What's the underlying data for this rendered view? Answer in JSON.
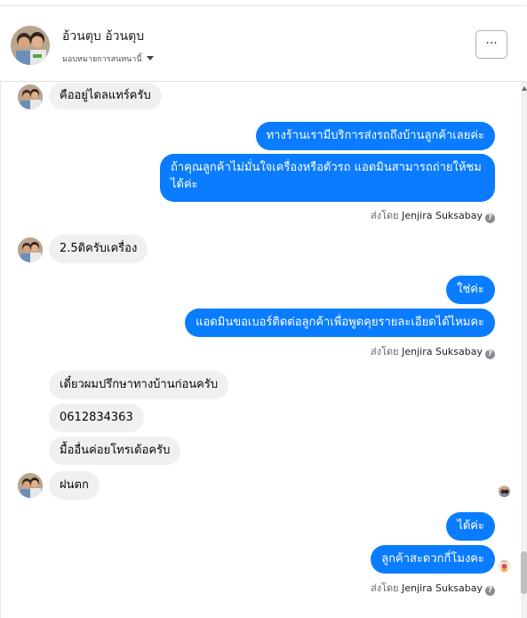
{
  "header": {
    "name": "อ้วนตุบ อ้วนตุบ",
    "subtitle": "มอบหมายการสนทนานี้",
    "more_label": "···"
  },
  "messages": {
    "m1": "คืออยู่ไดลแทร์ครับ",
    "m2": "ทางร้านเรามีบริการส่งรถถึงบ้านลูกค้าเลยค่ะ",
    "m3": "ถ้าคุณลูกค้าไม่มั่นใจเครื่องหรือตัวรถ แอดมินสามารถถ่ายให้ชมได้ค่ะ",
    "m4": "2.5ดิครับเครื่อง",
    "m5": "ใช่ค่ะ",
    "m6": "แอดมินขอเบอร์ติดต่อลูกค้าเพื่อพูดคุยรายละเอียดได้ไหมคะ",
    "m7": "เดี๋ยวผมปรึกษาทางบ้านก่อนครับ",
    "m8": "0612834363",
    "m9": "มื้ออื่นค่อยโทรเด้อครับ",
    "m10": "ฝนตก",
    "m11": "ได้ค่ะ",
    "m12": "ลูกค้าสะดวกกี่โมงคะ"
  },
  "sent_by": {
    "prefix": "ส่งโดย",
    "agent": "Jenjira Suksabay",
    "help": "?"
  }
}
